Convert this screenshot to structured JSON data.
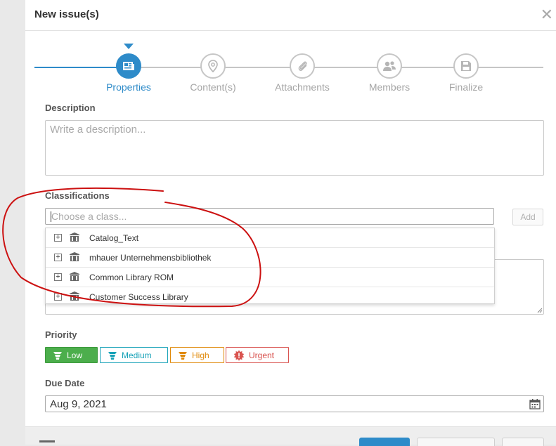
{
  "dialog": {
    "title": "New issue(s)",
    "close_icon": "close-icon"
  },
  "stepper": {
    "steps": [
      {
        "label": "Properties",
        "icon": "properties-icon",
        "active": true
      },
      {
        "label": "Content(s)",
        "icon": "location-pin-icon",
        "active": false
      },
      {
        "label": "Attachments",
        "icon": "paperclip-icon",
        "active": false
      },
      {
        "label": "Members",
        "icon": "members-icon",
        "active": false
      },
      {
        "label": "Finalize",
        "icon": "save-icon",
        "active": false
      }
    ],
    "accent": "#2e8bc9"
  },
  "description": {
    "label": "Description",
    "placeholder": "Write a description..."
  },
  "classifications": {
    "label": "Classifications",
    "placeholder": "Choose a class...",
    "add_label": "Add",
    "options": [
      {
        "label": "Catalog_Text"
      },
      {
        "label": "mhauer Unternehmensbibliothek"
      },
      {
        "label": "Common Library ROM"
      },
      {
        "label": "Customer Success Library"
      }
    ]
  },
  "priority": {
    "label": "Priority",
    "options": [
      {
        "label": "Low",
        "color": "#4cae4c",
        "selected": true
      },
      {
        "label": "Medium",
        "color": "#17a2b8",
        "selected": false
      },
      {
        "label": "High",
        "color": "#e08a0b",
        "selected": false
      },
      {
        "label": "Urgent",
        "color": "#d9534f",
        "selected": false
      }
    ]
  },
  "due_date": {
    "label": "Due Date",
    "value": "Aug 9, 2021"
  },
  "annotation_color": "#cc1111"
}
